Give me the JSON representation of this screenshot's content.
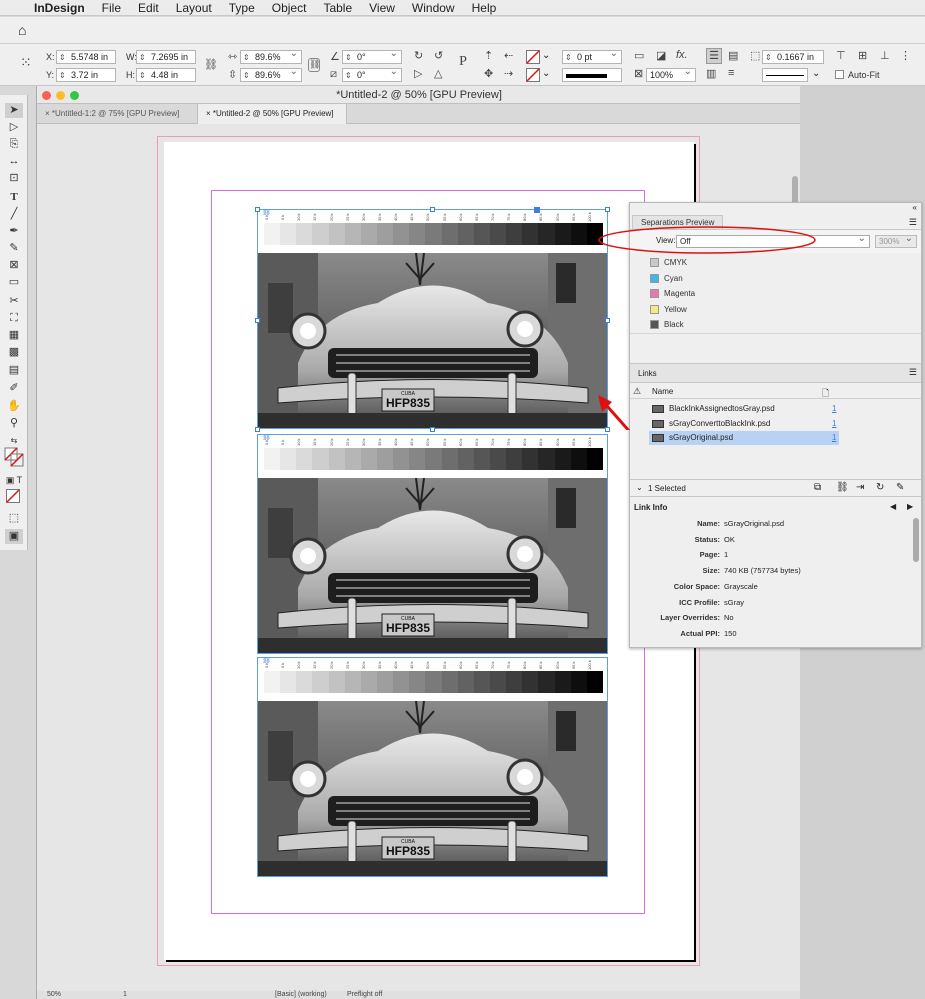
{
  "menubar": {
    "app": "InDesign",
    "items": [
      "File",
      "Edit",
      "Layout",
      "Type",
      "Object",
      "Table",
      "View",
      "Window",
      "Help"
    ]
  },
  "control": {
    "x_label": "X:",
    "x": "5.5748 in",
    "y_label": "Y:",
    "y": "3.72 in",
    "w_label": "W:",
    "w": "7.2695 in",
    "h_label": "H:",
    "h": "4.48 in",
    "scale_x": "89.6%",
    "scale_y": "89.6%",
    "rotate": "0°",
    "shear": "0°",
    "stroke_weight": "0 pt",
    "opacity": "100%",
    "inset": "0.1667 in",
    "autofit": "Auto-Fit",
    "p_label": "P"
  },
  "document": {
    "title": "*Untitled-2 @ 50% [GPU Preview]",
    "tabs": [
      {
        "label": "*Untitled-1:2 @ 75% [GPU Preview]",
        "active": false
      },
      {
        "label": "*Untitled-2 @ 50% [GPU Preview]",
        "active": true
      }
    ],
    "ramp_ticks": [
      "0 k",
      "5 k",
      "10 k",
      "15 k",
      "20 k",
      "25 k",
      "30 k",
      "35 k",
      "40 k",
      "45 k",
      "50 k",
      "55 k",
      "60 k",
      "65 k",
      "70 k",
      "75 k",
      "80 k",
      "85 k",
      "90 k",
      "95 k",
      "100 k"
    ],
    "plate": "HFP835",
    "plate_top": "CUBA",
    "status": {
      "zoom": "50%",
      "page": "1",
      "profile": "[Basic] (working)",
      "preflight": "Preflight off"
    }
  },
  "separations": {
    "tab": "Separations Preview",
    "view_label": "View:",
    "view_value": "Off",
    "zoom_value": "300%",
    "rows": [
      {
        "name": "CMYK",
        "color": "#c9c9c9"
      },
      {
        "name": "Cyan",
        "color": "#3fb7e6"
      },
      {
        "name": "Magenta",
        "color": "#e37ab0"
      },
      {
        "name": "Yellow",
        "color": "#f4e88a"
      },
      {
        "name": "Black",
        "color": "#555555"
      }
    ]
  },
  "links": {
    "tab": "Links",
    "col_name": "Name",
    "items": [
      {
        "name": "BlackInkAssignedtosGray.psd",
        "page": "1",
        "selected": false
      },
      {
        "name": "sGrayConverttoBlackInk.psd",
        "page": "1",
        "selected": false
      },
      {
        "name": "sGrayOriginal.psd",
        "page": "1",
        "selected": true
      }
    ],
    "selected_count": "1 Selected",
    "info_title": "Link Info",
    "info": [
      {
        "k": "Name:",
        "v": "sGrayOriginal.psd"
      },
      {
        "k": "Status:",
        "v": "OK"
      },
      {
        "k": "Page:",
        "v": "1"
      },
      {
        "k": "Size:",
        "v": "740 KB (757734 bytes)"
      },
      {
        "k": "Color Space:",
        "v": "Grayscale"
      },
      {
        "k": "ICC Profile:",
        "v": "sGray"
      },
      {
        "k": "Layer Overrides:",
        "v": "No"
      },
      {
        "k": "Actual PPI:",
        "v": "150"
      }
    ]
  },
  "colors": {
    "accent": "#3d7fe0",
    "annotation": "#e01010",
    "bleed": "#e89fb5",
    "margin": "#d86be0",
    "frame": "#5aa0e0"
  }
}
